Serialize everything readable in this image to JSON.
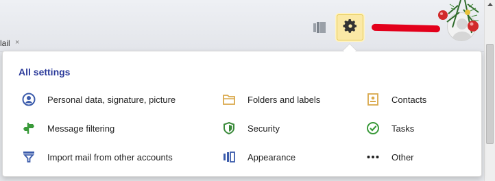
{
  "tab": {
    "label": "lail",
    "close": "×"
  },
  "header": {
    "user_name_redacted": ""
  },
  "settings_menu": {
    "title": "All settings",
    "items": [
      {
        "label": "Personal data, signature, picture",
        "icon": "person-icon"
      },
      {
        "label": "Folders and labels",
        "icon": "folder-icon"
      },
      {
        "label": "Contacts",
        "icon": "contacts-icon"
      },
      {
        "label": "Message filtering",
        "icon": "filter-icon"
      },
      {
        "label": "Security",
        "icon": "shield-icon"
      },
      {
        "label": "Tasks",
        "icon": "check-icon"
      },
      {
        "label": "Import mail from other accounts",
        "icon": "import-icon"
      },
      {
        "label": "Appearance",
        "icon": "appearance-icon"
      },
      {
        "label": "Other",
        "icon": "more-icon"
      }
    ]
  },
  "colors": {
    "title": "#2b3a9a",
    "person_icon": "#3b5bab",
    "folder_icon": "#d9a84a",
    "contacts_icon": "#d9a84a",
    "filter_icon": "#3a9a3a",
    "shield_icon": "#3a8a3a",
    "check_icon": "#3a9a3a",
    "import_icon": "#3b5bab",
    "appearance_icon": "#3b5bab",
    "settings_button_bg": "#fbe9a6"
  }
}
